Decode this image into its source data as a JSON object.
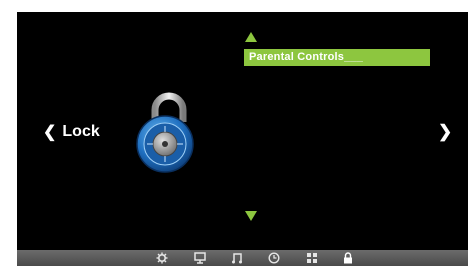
{
  "nav": {
    "left_chevron": "❮",
    "current_label": "Lock",
    "right_chevron": "❯"
  },
  "menu": {
    "selected_item": "Parental Controls___"
  },
  "colors": {
    "accent": "#8dc63f",
    "background": "#000000",
    "bar": "#5a5a5a"
  },
  "bottom_bar": {
    "icons": [
      "gear-icon",
      "monitor-icon",
      "music-note-icon",
      "clock-icon",
      "apps-grid-icon",
      "lock-icon"
    ],
    "active": "lock-icon"
  }
}
